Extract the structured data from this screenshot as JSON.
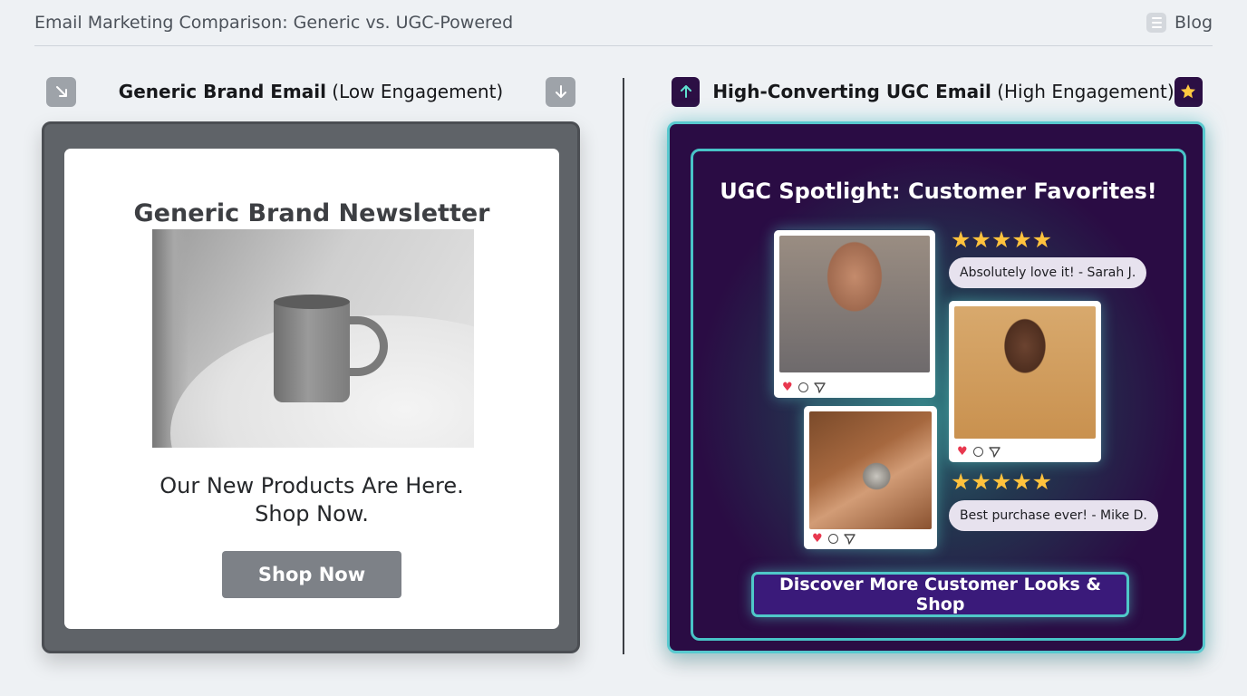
{
  "header": {
    "title": "Email Marketing Comparison: Generic vs. UGC-Powered",
    "blog_label": "Blog"
  },
  "left": {
    "heading_bold": "Generic Brand Email",
    "heading_rest": "(Low Engagement)",
    "icon_left": "arrow-down-right-icon",
    "icon_right": "arrow-down-icon",
    "email": {
      "title": "Generic Brand Newsletter",
      "body_line1": "Our New Products Are Here.",
      "body_line2": "Shop Now.",
      "button_label": "Shop Now"
    }
  },
  "right": {
    "heading_bold": "High-Converting UGC Email",
    "heading_rest": "(High Engagement)",
    "icon_left": "arrow-up-icon",
    "icon_right": "star-icon",
    "email": {
      "title": "UGC Spotlight: Customer Favorites!",
      "review1": {
        "stars": "★★★★★",
        "text": "Absolutely love it! - Sarah J."
      },
      "review2": {
        "stars": "★★★★★",
        "text": "Best purchase ever! - Mike D."
      },
      "button_label": "Discover More Customer Looks & Shop"
    }
  },
  "colors": {
    "ugc_background": "#2a0c44",
    "ugc_accent": "#58c9cf",
    "generic_button": "#7d8187",
    "star": "#ffc23d"
  }
}
